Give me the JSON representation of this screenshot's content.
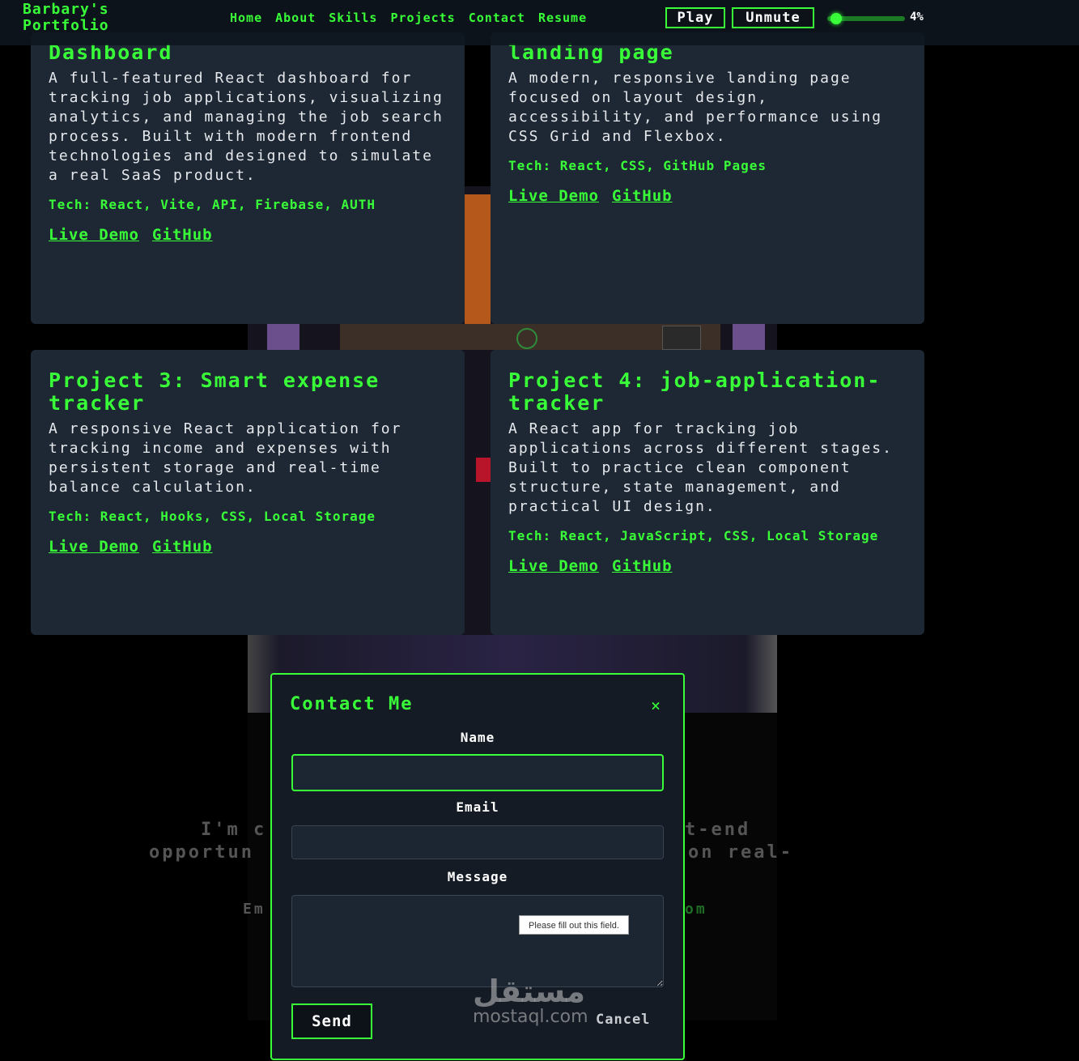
{
  "header": {
    "logo": "Barbary's Portfolio",
    "nav": [
      "Home",
      "About",
      "Skills",
      "Projects",
      "Contact",
      "Resume"
    ],
    "play_label": "Play",
    "unmute_label": "Unmute",
    "volume_percent_label": "4%",
    "volume_level": 0.04
  },
  "projects": [
    {
      "title": "Dashboard",
      "description": "A full-featured React dashboard for tracking job applications, visualizing analytics, and managing the job search process. Built with modern frontend technologies and designed to simulate a real SaaS product.",
      "tech": "Tech: React, Vite, API, Firebase, AUTH",
      "demo_label": "Live Demo",
      "github_label": "GitHub"
    },
    {
      "title": "landing page",
      "description": "A modern, responsive landing page focused on layout design, accessibility, and performance using CSS Grid and Flexbox.",
      "tech": "Tech: React, CSS, GitHub Pages",
      "demo_label": "Live Demo",
      "github_label": "GitHub"
    },
    {
      "title": "Project 3: Smart expense tracker",
      "description": "A responsive React application for tracking income and expenses with persistent storage and real-time balance calculation.",
      "tech": "Tech: React, Hooks, CSS, Local Storage",
      "demo_label": "Live Demo",
      "github_label": "GitHub"
    },
    {
      "title": "Project 4: job-application-tracker",
      "description": "A React app for tracking job applications across different stages. Built to practice clean component structure, state management, and practical UI design.",
      "tech": "Tech: React, JavaScript, CSS, Local Storage",
      "demo_label": "Live Demo",
      "github_label": "GitHub"
    }
  ],
  "background_text": {
    "line1_left": "I'm c",
    "line1_right": "t-end",
    "line2_left": "opportun",
    "line2_right": "on real-",
    "line3_left": "Em",
    "line3_right": "om"
  },
  "contact_modal": {
    "title": "Contact Me",
    "close_symbol": "×",
    "name_label": "Name",
    "name_value": "",
    "email_label": "Email",
    "email_value": "",
    "message_label": "Message",
    "message_value": "",
    "validation_tooltip": "Please fill out this field.",
    "send_label": "Send",
    "cancel_label": "Cancel"
  },
  "watermark": {
    "arabic": "مستقل",
    "latin": "mostaql.com"
  },
  "colors": {
    "accent": "#38ff38",
    "card_bg": "#1e2734",
    "modal_bg": "#141b24"
  }
}
